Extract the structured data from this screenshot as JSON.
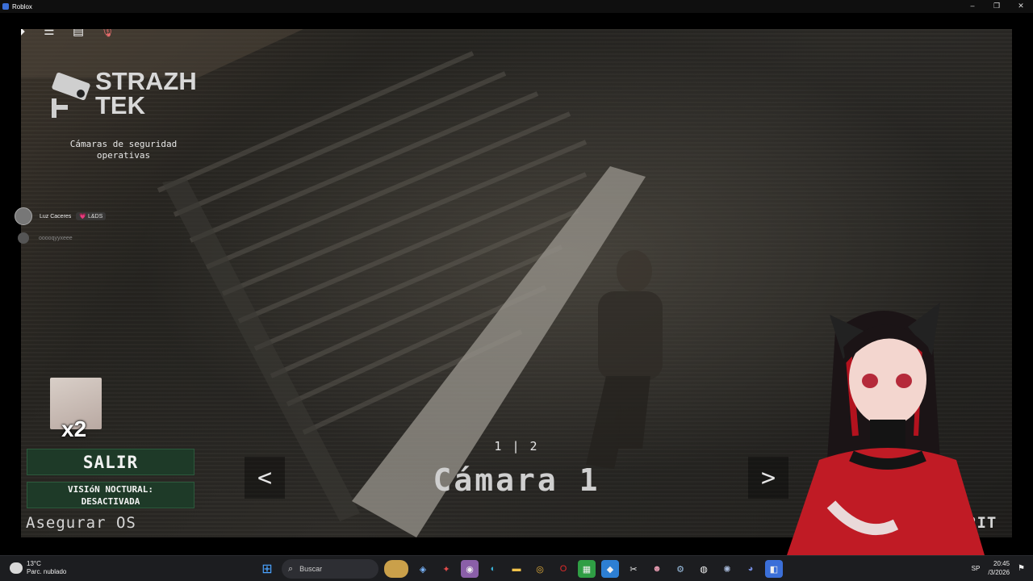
{
  "window": {
    "title": "Roblox",
    "controls": [
      "–",
      "❐",
      "✕"
    ]
  },
  "roblox_menu": [
    "roblox-logo-icon",
    "menu-icon",
    "chat-icon",
    "mic-muted-icon"
  ],
  "logo": {
    "line1": "STRAZH",
    "line2": "TEK"
  },
  "subtitle": {
    "line1": "Cámaras de seguridad",
    "line2": "operativas"
  },
  "users": [
    {
      "name": "Luz Caceres",
      "tag": "💗 L&DS"
    },
    {
      "name": "ooooqyyxeee"
    }
  ],
  "multiplier": "x2",
  "buttons": {
    "salir": "SALIR",
    "vision_line1": "VISIóN NOCTURAL:",
    "vision_line2": "DESACTIVADA",
    "asegurar": "Asegurar OS"
  },
  "camera": {
    "index": "1 | 2",
    "label": "Cámara 1",
    "prev": "<",
    "next": ">",
    "right_text": "RIT"
  },
  "taskbar": {
    "temp": "13°C",
    "weather": "Parc. nublado",
    "search_placeholder": "Buscar",
    "lang": "SP",
    "time": "20:45",
    "date": "/3/2026"
  },
  "colors": {
    "button_bg": "#1e3a28",
    "taskbar_bg": "#1c1d20",
    "titlebar_bg": "#0f0f0f"
  }
}
